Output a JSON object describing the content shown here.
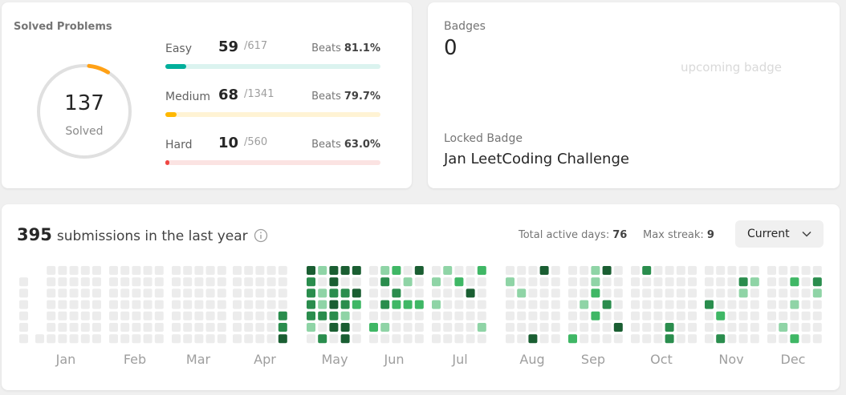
{
  "solved": {
    "title": "Solved Problems",
    "total": "137",
    "total_label": "Solved",
    "ring_fraction": 0.07,
    "ring_color": "#ffa116",
    "rows": [
      {
        "name": "Easy",
        "count": "59",
        "total": "/617",
        "beats_label": "Beats",
        "beats": "81.1%",
        "fraction": 0.096,
        "color": "#00af9b",
        "track": "#dbf3ef"
      },
      {
        "name": "Medium",
        "count": "68",
        "total": "/1341",
        "beats_label": "Beats",
        "beats": "79.7%",
        "fraction": 0.051,
        "color": "#ffb800",
        "track": "#fff3d4"
      },
      {
        "name": "Hard",
        "count": "10",
        "total": "/560",
        "beats_label": "Beats",
        "beats": "63.0%",
        "fraction": 0.018,
        "color": "#ef4743",
        "track": "#fbe3e2"
      }
    ]
  },
  "badges": {
    "label": "Badges",
    "count": "0",
    "upcoming_alt": "upcoming badge",
    "locked_label": "Locked Badge",
    "locked_name": "Jan LeetCoding Challenge"
  },
  "submissions": {
    "count": "395",
    "suffix": "submissions in the last year",
    "active_days_label": "Total active days:",
    "active_days": "76",
    "max_streak_label": "Max streak:",
    "max_streak": "9",
    "dropdown_value": "Current"
  },
  "heatmap": {
    "months": [
      "Jan",
      "Feb",
      "Mar",
      "Apr",
      "May",
      "Jun",
      "Jul",
      "Aug",
      "Sep",
      "Oct",
      "Nov",
      "Dec"
    ],
    "colors": {
      "0": "#ececec",
      "1": "#8fd4a6",
      "2": "#3fb765",
      "3": "#2a8d4d",
      "4": "#1a5e32"
    }
  }
}
